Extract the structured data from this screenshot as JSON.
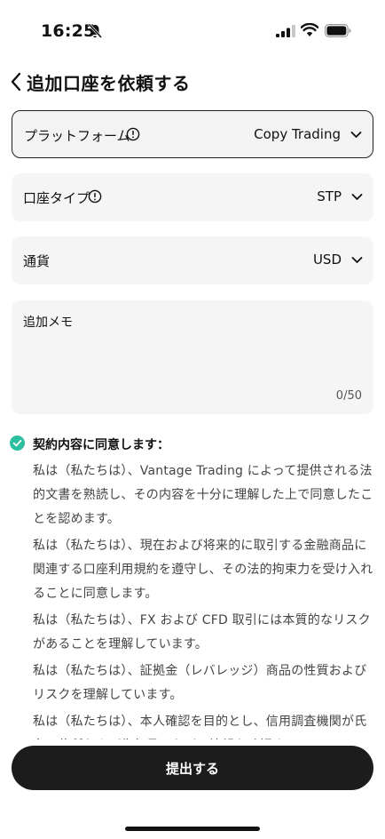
{
  "status_bar": {
    "time": "16:25"
  },
  "header": {
    "title": "追加口座を依頼する"
  },
  "fields": {
    "platform": {
      "label": "プラットフォーム",
      "value": "Copy Trading"
    },
    "account_type": {
      "label": "口座タイプ",
      "value": "STP"
    },
    "currency": {
      "label": "通貨",
      "value": "USD"
    }
  },
  "memo": {
    "label": "追加メモ",
    "count": "0/50"
  },
  "agreement": {
    "title": "契約内容に同意します：",
    "paragraphs": [
      "私は（私たちは）、Vantage Trading によって提供される法的文書を熟読し、その内容を十分に理解した上で同意したことを認めます。",
      "私は（私たちは）、現在および将来的に取引する金融商品に関連する口座利用規約を遵守し、その法的拘束力を受け入れることに同意します。",
      "私は（私たちは）、FX および CFD 取引には本質的なリスクがあることを理解しています。",
      "私は（私たちは）、証拠金（レバレッジ）商品の性質およびリスクを理解しています。",
      "私は（私たちは）、本人確認を目的とし、信用調査機関が氏名、住所および生年月日などの情報を確認することに"
    ]
  },
  "submit": {
    "label": "提出する"
  },
  "colors": {
    "accent_check": "#2bbfa0",
    "button_bg": "#1c1c1c",
    "field_bg": "#f5f5f5"
  }
}
